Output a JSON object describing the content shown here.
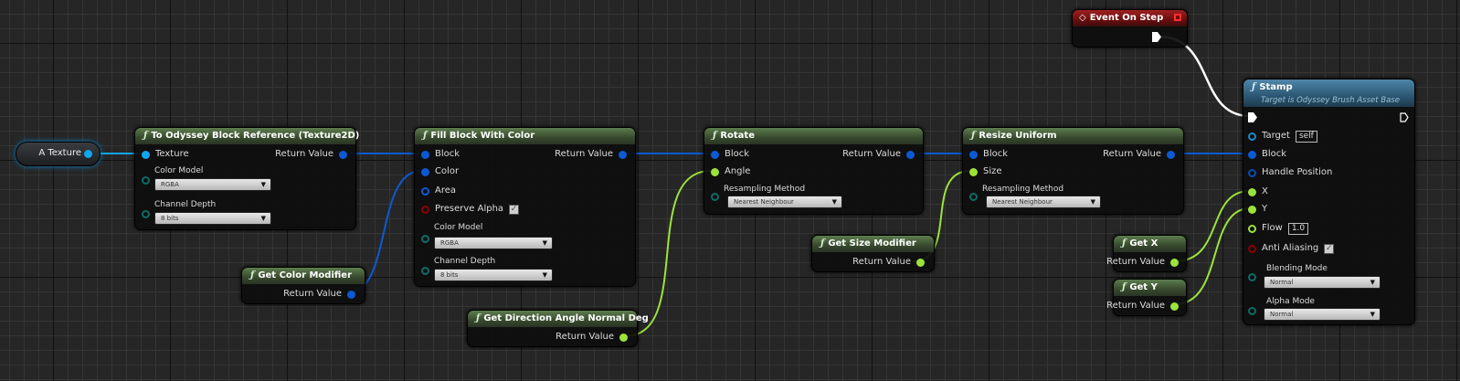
{
  "colors": {
    "object": "#0fa6ee",
    "struct": "#0b5ad4",
    "float": "#9be33a",
    "enum": "#0e6b66",
    "bool": "#8a0000",
    "exec": "#ffffff",
    "target": "#1a8bc4"
  },
  "variable": {
    "label": "A Texture"
  },
  "to_block": {
    "title": "To Odyssey Block Reference (Texture2D)",
    "texture": "Texture",
    "return": "Return Value",
    "color_model_label": "Color Model",
    "color_model": "RGBA",
    "channel_depth_label": "Channel Depth",
    "channel_depth": "8 bits"
  },
  "get_color_modifier": {
    "title": "Get Color Modifier",
    "return": "Return Value"
  },
  "fill": {
    "title": "Fill Block With Color",
    "block": "Block",
    "color": "Color",
    "area": "Area",
    "preserve_alpha": "Preserve Alpha",
    "preserve_alpha_checked": true,
    "return": "Return Value",
    "color_model_label": "Color Model",
    "color_model": "RGBA",
    "channel_depth_label": "Channel Depth",
    "channel_depth": "8 bits"
  },
  "get_direction": {
    "title": "Get Direction Angle Normal Deg",
    "return": "Return Value"
  },
  "rotate": {
    "title": "Rotate",
    "block": "Block",
    "angle": "Angle",
    "return": "Return Value",
    "resampling_label": "Resampling Method",
    "resampling": "Nearest Neighbour"
  },
  "get_size_modifier": {
    "title": "Get Size Modifier",
    "return": "Return Value"
  },
  "resize": {
    "title": "Resize Uniform",
    "block": "Block",
    "size": "Size",
    "return": "Return Value",
    "resampling_label": "Resampling Method",
    "resampling": "Nearest Neighbour"
  },
  "event": {
    "title": "Event On Step"
  },
  "get_x": {
    "title": "Get X",
    "return": "Return Value"
  },
  "get_y": {
    "title": "Get Y",
    "return": "Return Value"
  },
  "stamp": {
    "title": "Stamp",
    "subtitle": "Target is Odyssey Brush Asset Base",
    "target": "Target",
    "target_value": "self",
    "block": "Block",
    "handle_position": "Handle Position",
    "x": "X",
    "y": "Y",
    "flow": "Flow",
    "flow_value": "1.0",
    "anti_aliasing": "Anti Aliasing",
    "anti_aliasing_checked": true,
    "blending_label": "Blending Mode",
    "blending": "Normal",
    "alpha_label": "Alpha Mode",
    "alpha": "Normal"
  },
  "icons": {
    "function": "ƒ",
    "event": "◇",
    "check": "✓"
  }
}
